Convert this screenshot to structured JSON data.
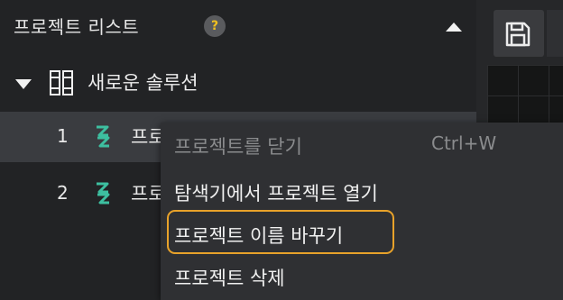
{
  "panel": {
    "title": "프로젝트 리스트",
    "help_icon": "?",
    "solution": {
      "label": "새로운 솔루션"
    },
    "projects": [
      {
        "index": "1",
        "name": "프로"
      },
      {
        "index": "2",
        "name": "프로"
      }
    ]
  },
  "context_menu": {
    "items": [
      {
        "label": "프로젝트를 닫기",
        "shortcut": "Ctrl+W",
        "enabled": false
      },
      {
        "label": "탐색기에서 프로젝트 열기",
        "shortcut": "",
        "enabled": true
      },
      {
        "label": "프로젝트 이름 바꾸기",
        "shortcut": "",
        "enabled": true,
        "highlighted": true
      },
      {
        "label": "프로젝트 삭제",
        "shortcut": "",
        "enabled": true
      }
    ]
  },
  "colors": {
    "highlight_outline": "#e8a22a",
    "project_icon": "#3dbfa0",
    "help_icon": "#f0c020"
  },
  "icons": {
    "help": "question-icon",
    "collapse": "triangle-up-icon",
    "expand": "triangle-down-icon",
    "solution": "binder-icon",
    "project": "project-icon",
    "save": "save-icon"
  }
}
